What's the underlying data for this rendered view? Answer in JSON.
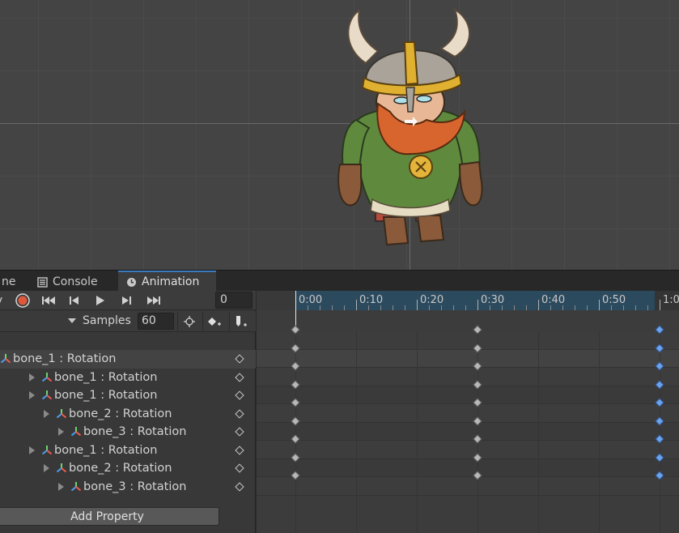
{
  "tabs": [
    {
      "label": "ne",
      "icon": "hierarchy-icon"
    },
    {
      "label": "Console",
      "icon": "console-icon"
    },
    {
      "label": "Animation",
      "icon": "animation-clock-icon"
    }
  ],
  "playback": {
    "preview_label": "y",
    "frame": "0"
  },
  "samples": {
    "label": "Samples",
    "value": "60"
  },
  "properties": [
    {
      "label": "bone_1 : Rotation",
      "indent": 0,
      "expandable": false
    },
    {
      "label": "bone_1 : Rotation",
      "indent": 1,
      "expandable": true
    },
    {
      "label": "bone_1 : Rotation",
      "indent": 1,
      "expandable": true
    },
    {
      "label": "bone_2 : Rotation",
      "indent": 2,
      "expandable": true
    },
    {
      "label": "bone_3 : Rotation",
      "indent": 3,
      "expandable": true
    },
    {
      "label": "bone_1 : Rotation",
      "indent": 1,
      "expandable": true
    },
    {
      "label": "bone_2 : Rotation",
      "indent": 2,
      "expandable": true
    },
    {
      "label": "bone_3 : Rotation",
      "indent": 3,
      "expandable": true
    }
  ],
  "add_property_label": "Add Property",
  "ruler": {
    "labels": [
      "0:00",
      "0:10",
      "0:20",
      "0:30",
      "0:40",
      "0:50",
      "1:0"
    ]
  },
  "keyframe_times": [
    "0:00",
    "0:30",
    "1:00"
  ],
  "colors": {
    "record": "#e0573a",
    "key_selected": "#6aa2f0",
    "tab_accent": "#3a79bb"
  }
}
